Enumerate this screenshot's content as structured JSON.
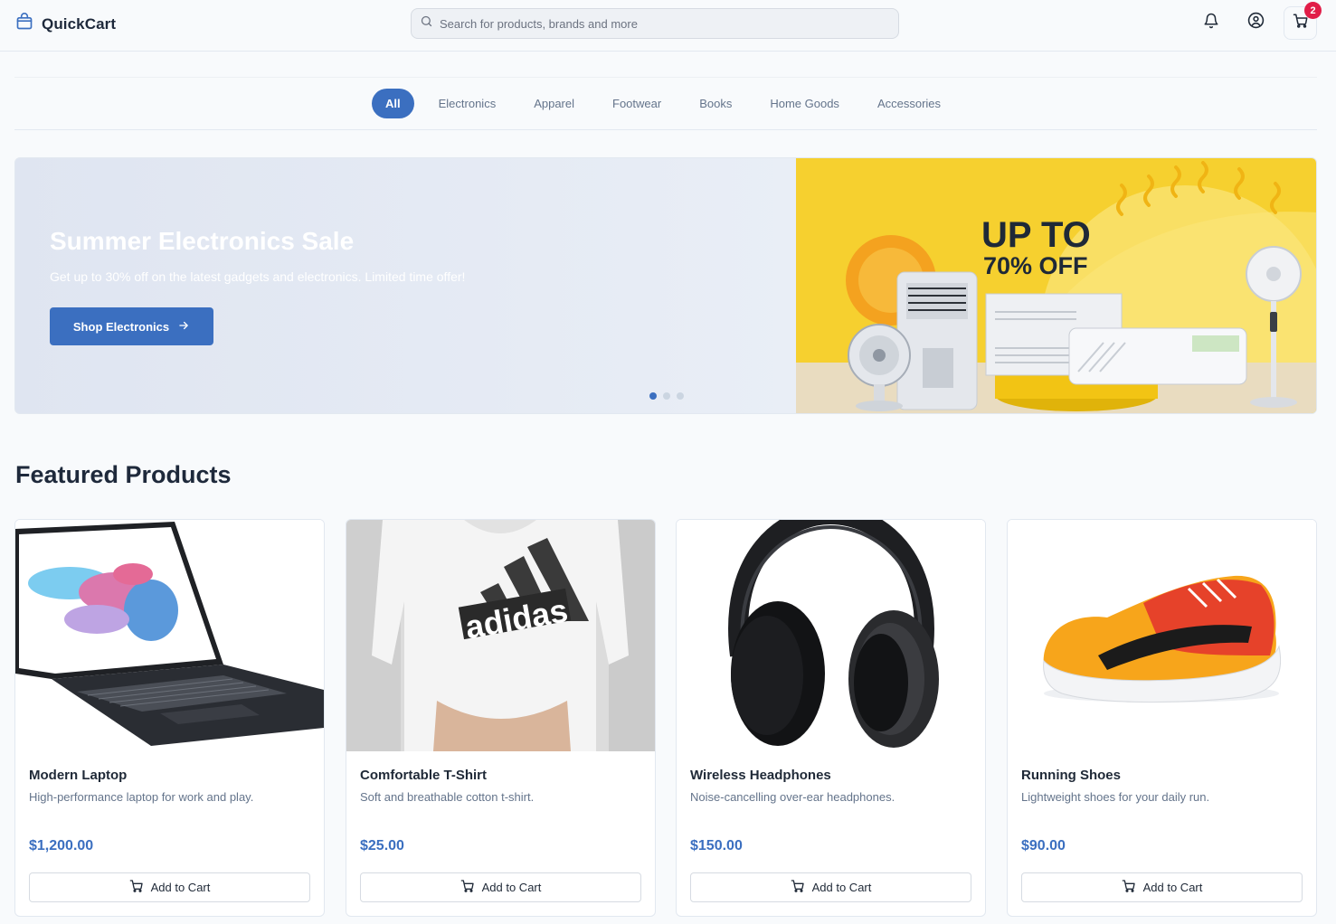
{
  "header": {
    "brand": "QuickCart",
    "search_placeholder": "Search for products, brands and more",
    "cart_count": "2"
  },
  "categories": [
    {
      "label": "All",
      "active": true
    },
    {
      "label": "Electronics"
    },
    {
      "label": "Apparel"
    },
    {
      "label": "Footwear"
    },
    {
      "label": "Books"
    },
    {
      "label": "Home Goods"
    },
    {
      "label": "Accessories"
    }
  ],
  "hero": {
    "title": "Summer Electronics Sale",
    "subtitle": "Get up to 30% off on the latest gadgets and electronics. Limited time offer!",
    "button": "Shop Electronics",
    "banner_line1": "UP TO",
    "banner_line2": "70% OFF",
    "slides": 3,
    "active_slide": 1
  },
  "featured": {
    "title": "Featured Products",
    "products": [
      {
        "name": "Modern Laptop",
        "description": "High-performance laptop for work and play.",
        "price": "$1,200.00",
        "button": "Add to Cart",
        "image": "laptop"
      },
      {
        "name": "Comfortable T-Shirt",
        "description": "Soft and breathable cotton t-shirt.",
        "price": "$25.00",
        "button": "Add to Cart",
        "image": "tshirt",
        "image_text": "adidas"
      },
      {
        "name": "Wireless Headphones",
        "description": "Noise-cancelling over-ear headphones.",
        "price": "$150.00",
        "button": "Add to Cart",
        "image": "headphones"
      },
      {
        "name": "Running Shoes",
        "description": "Lightweight shoes for your daily run.",
        "price": "$90.00",
        "button": "Add to Cart",
        "image": "shoes"
      }
    ]
  },
  "colors": {
    "accent": "#3b6fc0",
    "badge": "#e11d48",
    "banner_yellow": "#f6d02f"
  },
  "icons": [
    "bag-icon",
    "search-icon",
    "bell-icon",
    "user-icon",
    "cart-icon",
    "arrow-right-icon"
  ]
}
